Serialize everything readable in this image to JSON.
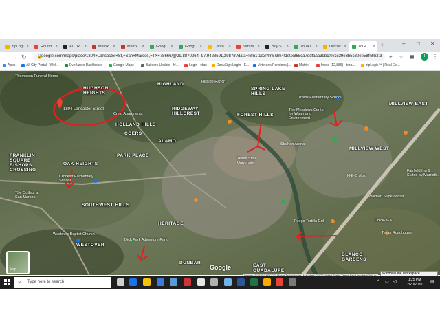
{
  "tabs": [
    {
      "label": "zipLogi",
      "color": "#f4b400",
      "active": false
    },
    {
      "label": "Round",
      "color": "#ea4335",
      "active": false
    },
    {
      "label": "ACTRI",
      "color": "#202124",
      "active": false
    },
    {
      "label": "Matrix",
      "color": "#c0392b",
      "active": false
    },
    {
      "label": "Matrix",
      "color": "#c0392b",
      "active": false
    },
    {
      "label": "Googl",
      "color": "#34a853",
      "active": false
    },
    {
      "label": "Googl",
      "color": "#34a853",
      "active": false
    },
    {
      "label": "Canto",
      "color": "#fbbc05",
      "active": false
    },
    {
      "label": "San M",
      "color": "#ea4335",
      "active": false
    },
    {
      "label": "Buy S",
      "color": "#202124",
      "active": false
    },
    {
      "label": "1804 L",
      "color": "#34a853",
      "active": false
    },
    {
      "label": "Discov",
      "color": "#f4b400",
      "active": false
    },
    {
      "label": "1804 L",
      "color": "#34a853",
      "active": true
    }
  ],
  "browser": {
    "url": "google.com/maps/place/1804+Lancaster+St,+San+Marcos,+TX+78666/@29.8870264,-97.9428591,2987m/data=!3m1!1e3!4m5!3m4!1s0x865ca7ddfaaa39b1:0xcc39e3b5c80ee58f!8m2!3d29.89...",
    "avatar": "T"
  },
  "bookmarks": [
    {
      "label": "Apps",
      "color": "#4285f4"
    },
    {
      "label": "All City Portal - Wel...",
      "color": "#1a73e8"
    },
    {
      "label": "Everlance Dashboard",
      "color": "#1e8e3e"
    },
    {
      "label": "Google Maps",
      "color": "#34a853"
    },
    {
      "label": "Builders Update - H...",
      "color": "#5f6368"
    },
    {
      "label": "Login | efax",
      "color": "#ea4335"
    },
    {
      "label": "DocuSign Login - E...",
      "color": "#f9ab00"
    },
    {
      "label": "Veterans Pensions |...",
      "color": "#1a73e8"
    },
    {
      "label": "Matrix",
      "color": "#c0392b"
    },
    {
      "label": "Inbox (12,886) - tera...",
      "color": "#ea4335"
    },
    {
      "label": "zipLogix™ | Real Est...",
      "color": "#f4b400"
    }
  ],
  "map": {
    "neighborhoods": [
      "HUGHSON HEIGHTS",
      "HIGHLAND",
      "SPRING LAKE HILLS",
      "MILLVIEW EAST",
      "RIDGEWAY HILLCREST",
      "FOREST HILLS",
      "HOLLAND HILLS",
      "COERS",
      "ALAMO",
      "PARK PLACE",
      "FRANKLIN SQUARE BISHOPS CROSSING",
      "OAK HEIGHTS",
      "SOUTHWEST HILLS",
      "WESTOVER",
      "HERITAGE",
      "DUNBAR",
      "EAST GUADALUPE",
      "BLANCO GARDENS",
      "MILLVIEW WEST"
    ],
    "places": [
      "Thompson Funeral Home",
      "Hillside Ranch",
      "Travis Elementary School",
      "The Meadows Center for Water and Environment",
      "Crest Apartments",
      "Texas State University",
      "Strahan Arena",
      "Fairfield Inn & Suites by Marriott...",
      "Crockett Elementary School",
      "The Outlets at San Marcos",
      "Westover Baptist Church",
      "Dick Park Adventure Park",
      "Fuego Tortilla Grill",
      "H-E-B plus!",
      "Walmart Supercenter",
      "Chick-fil-A",
      "Texas Roadhouse"
    ],
    "address_label": "1804 Lancaster Street",
    "google_logo": "Google",
    "attribution": "Imagery ©2020 CAPCOG, Maxar Technologies, Map data ©2020   United States   Terms   Send feedback   500 m",
    "layer_label": "Map"
  },
  "winink": "Windows Ink Workspace",
  "taskbar": {
    "search_placeholder": "Type here to search",
    "time": "1:25 PM",
    "date": "2/20/2020"
  }
}
